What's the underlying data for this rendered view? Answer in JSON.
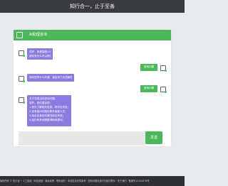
{
  "header": {
    "title": "知行合一，止于至善"
  },
  "chat": {
    "title": "AI助理咨询",
    "messages": [
      {
        "from": "bot",
        "lines": [
          "您好，我是智能小助，",
          "请问有什么可以帮您？"
        ]
      },
      {
        "from": "user",
        "text": "咨询问题"
      },
      {
        "from": "bot",
        "lines": [
          "请问您有什么问题，我会尽力为您解答。"
        ]
      },
      {
        "from": "user",
        "text": "咨询问题"
      },
      {
        "from": "bot",
        "lines": [
          "关于您提出的咨询问题：",
          "您好，我们建议您：",
          "1.首先了解相关信息，再作出决定；",
          "2.如有疑问可随时联系客服人员；",
          "3.结合自身实际情况综合考虑；",
          "4.如仍有其他需要请继续提问。"
        ]
      }
    ],
    "input_placeholder": "",
    "send_label": "发送"
  },
  "footer": {
    "text": "版权所有 © 知行合一 人工智能 · 网站地图 · 隐私政策 · 联系我们 · 本站信息仅供参考 · 如有问题请及时与我们联系 · 关于我们 · 备案号12345678号"
  },
  "colors": {
    "accent": "#4cb75b",
    "bot_bubble": "#8c7bdf",
    "topbar": "#3a3b3f",
    "footer": "#2f3034"
  },
  "icons": [
    "chat-icon",
    "bot-avatar-icon",
    "user-avatar-icon"
  ]
}
